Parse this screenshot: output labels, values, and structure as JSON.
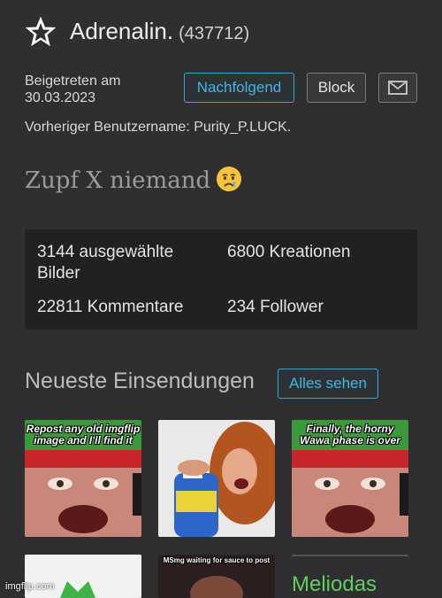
{
  "profile": {
    "username": "Adrenalin.",
    "user_id": "(437712)",
    "joined_label": "Beigetreten am",
    "joined_date": "30.03.2023",
    "previous_username": "Vorheriger Benutzername: Purity_P.LUCK.",
    "bio": "Zupf X niemand",
    "bio_emoji_icon": "crying-face-emoji-icon"
  },
  "actions": {
    "follow_label": "Nachfolgend",
    "block_label": "Block",
    "message_icon": "envelope-icon"
  },
  "stats": {
    "featured_images": "3144 ausgewählte Bilder",
    "creations": "6800 Kreationen",
    "comments": "22811 Kommentare",
    "followers": "234 Follower"
  },
  "recent": {
    "title": "Neueste Einsendungen",
    "all_label": "Alles sehen",
    "thumbnails": [
      {
        "caption": "Repost any old imgflip image and I'll find it"
      },
      {
        "caption": ""
      },
      {
        "caption": "Finally, the horny Wawa phase is over"
      },
      {
        "caption": ""
      },
      {
        "caption": "MSmg waiting for sauce to post"
      },
      {
        "caption": "Meliodas"
      }
    ]
  },
  "watermark": "imgflip.com",
  "colors": {
    "background": "#2f2f31",
    "accent": "#46b4e2",
    "stats_panel": "#212121"
  }
}
